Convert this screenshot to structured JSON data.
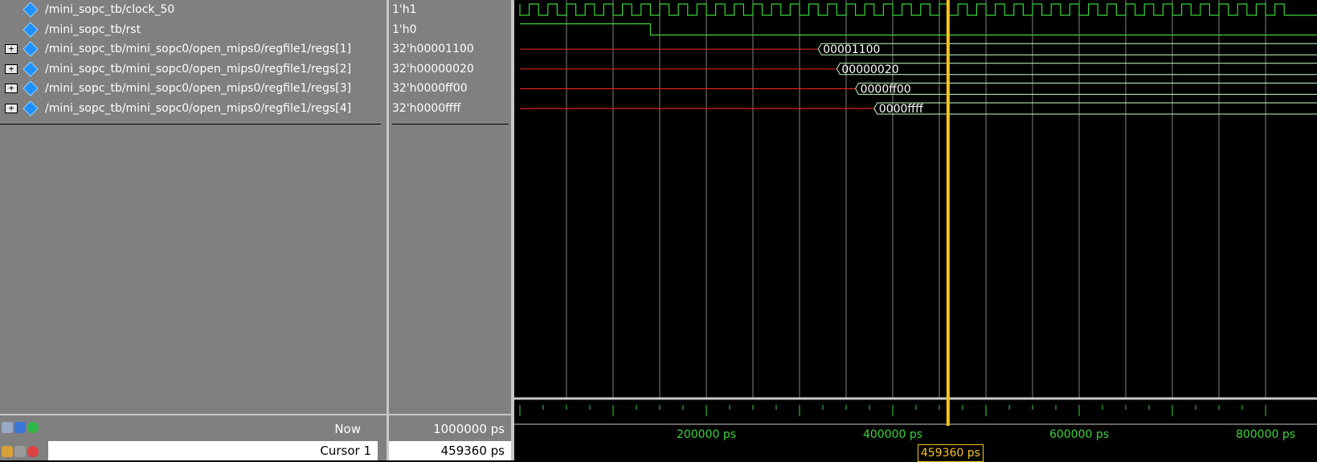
{
  "signals": [
    {
      "name": "/mini_sopc_tb/clock_50",
      "value": "1'h1",
      "expandable": false
    },
    {
      "name": "/mini_sopc_tb/rst",
      "value": "1'h0",
      "expandable": false
    },
    {
      "name": "/mini_sopc_tb/mini_sopc0/open_mips0/regfile1/regs[1]",
      "value": "32'h00001100",
      "expandable": true
    },
    {
      "name": "/mini_sopc_tb/mini_sopc0/open_mips0/regfile1/regs[2]",
      "value": "32'h00000020",
      "expandable": true
    },
    {
      "name": "/mini_sopc_tb/mini_sopc0/open_mips0/regfile1/regs[3]",
      "value": "32'h0000ff00",
      "expandable": true
    },
    {
      "name": "/mini_sopc_tb/mini_sopc0/open_mips0/regfile1/regs[4]",
      "value": "32'h0000ffff",
      "expandable": true
    }
  ],
  "bus_waves": [
    {
      "change_time_ps": 320000,
      "label": "00001100"
    },
    {
      "change_time_ps": 340000,
      "label": "00000020"
    },
    {
      "change_time_ps": 360000,
      "label": "0000ff00"
    },
    {
      "change_time_ps": 380000,
      "label": "0000ffff"
    }
  ],
  "clock_period_ps": 20000,
  "rst_deassert_ps": 140000,
  "view_start_ps": 0,
  "view_end_ps": 820000,
  "time_axis": {
    "major_labels": [
      "200000 ps",
      "400000 ps",
      "600000 ps",
      "800000 ps"
    ],
    "major_values_ps": [
      200000,
      400000,
      600000,
      800000
    ]
  },
  "status": {
    "now_label": "Now",
    "now_value": "1000000 ps",
    "cursor_label": "Cursor 1",
    "cursor_value": "459360 ps",
    "cursor_time_ps": 459360
  },
  "colors": {
    "wave": "#39d439",
    "undefined": "#e0201c",
    "bus": "#c8ffc8",
    "cursor": "#f7c518",
    "grid": "#7f7f7f",
    "diamond": "#1e90ff"
  },
  "icons": [
    "wave-toolbar-icon",
    "add-cursor-icon",
    "lock-cursor-icon",
    "edit-cursor-icon",
    "delete-cursor-icon"
  ]
}
